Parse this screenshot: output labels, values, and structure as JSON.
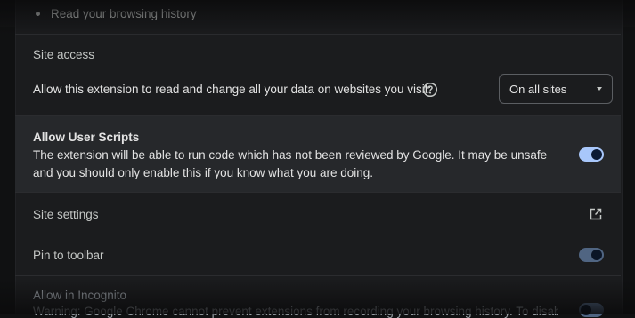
{
  "permissions": {
    "items": [
      "Read your browsing history"
    ]
  },
  "site_access": {
    "title": "Site access",
    "description": "Allow this extension to read and change all your data on websites you visit:",
    "dropdown_value": "On all sites",
    "help_icon": "help-circle-icon"
  },
  "user_scripts": {
    "title": "Allow User Scripts",
    "description": "The extension will be able to run code which has not been reviewed by Google. It may be unsafe and you should only enable this if you know what you are doing.",
    "enabled": true
  },
  "site_settings": {
    "label": "Site settings",
    "icon": "external-link-icon"
  },
  "pin_toolbar": {
    "label": "Pin to toolbar",
    "enabled": true
  },
  "incognito": {
    "label": "Allow in Incognito",
    "warning": "Warning: Google Chrome cannot prevent extensions from recording your browsing history. To disable"
  },
  "colors": {
    "background": "#1b1c1e",
    "highlight": "#26282b",
    "toggle_on": "#a8c7fa",
    "text": "#e3e3e3"
  }
}
